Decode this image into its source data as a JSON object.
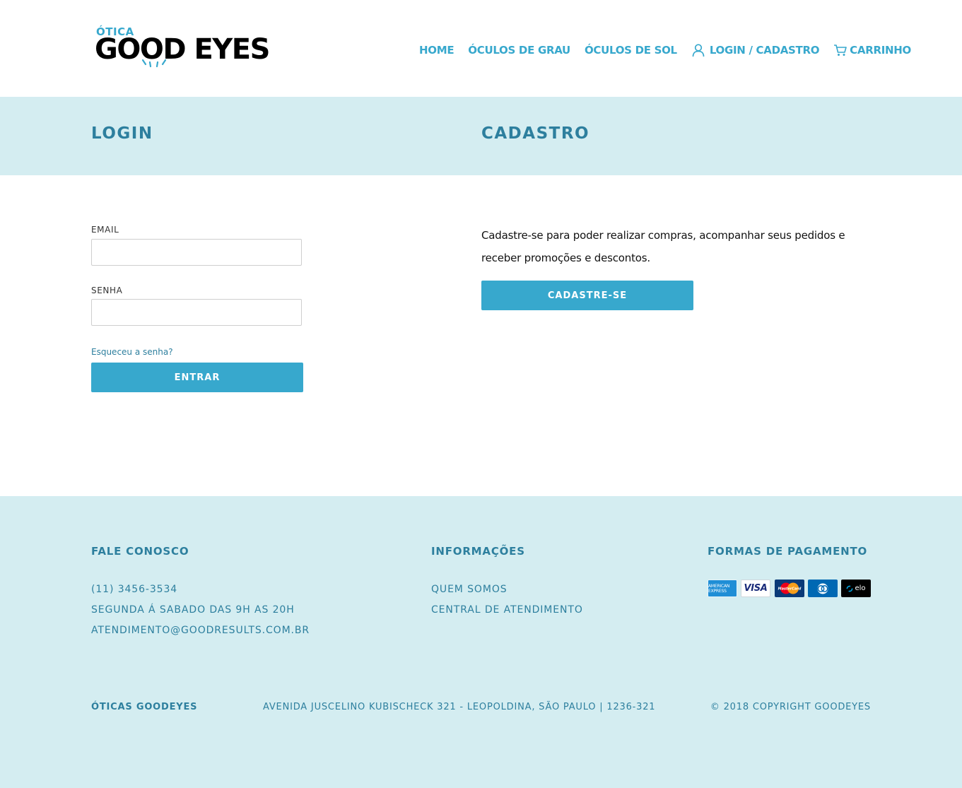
{
  "header": {
    "logo_small": "ÓTICA",
    "logo_big": "GOOD EYES",
    "nav": [
      {
        "label": "HOME"
      },
      {
        "label": "ÓCULOS DE GRAU"
      },
      {
        "label": "ÓCULOS DE SOL"
      },
      {
        "label": "LOGIN / CADASTRO",
        "icon": "user-icon"
      },
      {
        "label": "CARRINHO",
        "icon": "cart-icon"
      }
    ]
  },
  "login": {
    "title": "LOGIN",
    "email_label": "EMAIL",
    "email_value": "",
    "password_label": "SENHA",
    "password_value": "",
    "forgot_link": "Esqueceu a senha?",
    "submit_label": "ENTRAR"
  },
  "register": {
    "title": "CADASTRO",
    "description": "Cadastre-se para poder realizar compras, acompanhar seus pedidos e receber promoções e descontos.",
    "button_label": "CADASTRE-SE"
  },
  "footer": {
    "contact": {
      "title": "FALE CONOSCO",
      "phone": "(11) 3456-3534",
      "hours": "SEGUNDA Á SABADO DAS 9H AS 20H",
      "email": "ATENDIMENTO@GOODRESULTS.COM.BR"
    },
    "info": {
      "title": "INFORMAÇÕES",
      "links": [
        "QUEM SOMOS",
        "CENTRAL DE ATENDIMENTO"
      ]
    },
    "payment": {
      "title": "FORMAS DE PAGAMENTO",
      "cards": [
        {
          "name": "american-express-icon",
          "label": "AMERICAN EXPRESS",
          "color": "#1f8ed6"
        },
        {
          "name": "visa-icon",
          "label": "VISA",
          "color": "#ffffff"
        },
        {
          "name": "mastercard-icon",
          "label": "MasterCard",
          "color": "#0a3a78"
        },
        {
          "name": "diners-icon",
          "label": "",
          "color": "#0068b3"
        },
        {
          "name": "elo-icon",
          "label": "elo",
          "color": "#000000"
        }
      ]
    },
    "company": "ÓTICAS GOODEYES",
    "address": "AVENIDA JUSCELINO KUBISCHECK 321 - LEOPOLDINA, SÃO PAULO | 1236-321",
    "copyright": "© 2018 COPYRIGHT GOODEYES"
  },
  "colors": {
    "accent": "#37a8cd",
    "dark_accent": "#2d7f9e",
    "band": "#d4edf1"
  }
}
